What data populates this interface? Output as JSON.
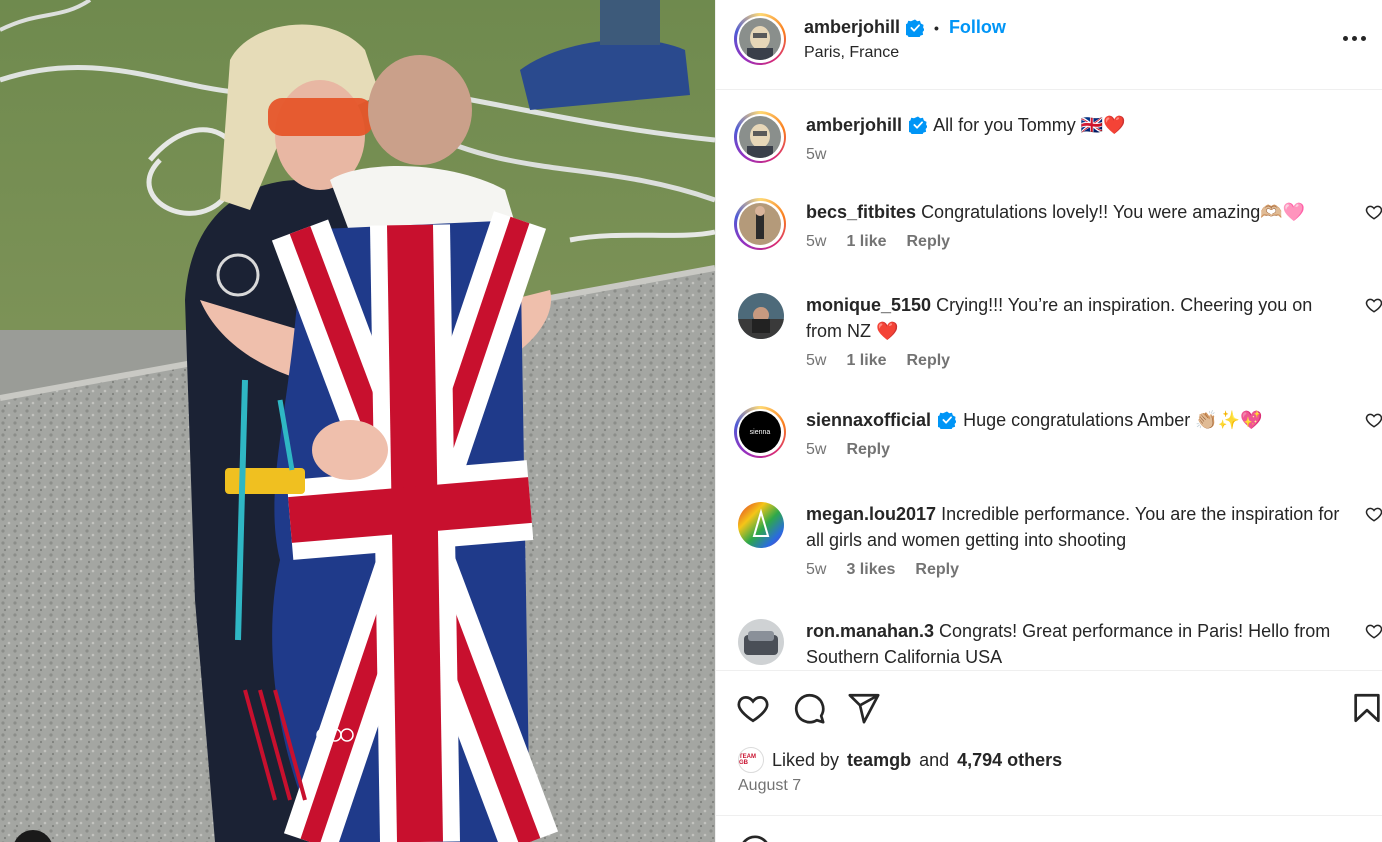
{
  "post": {
    "username": "amberjohill",
    "follow_label": "Follow",
    "separator": "•",
    "location": "Paris, France",
    "caption": {
      "username": "amberjohill",
      "text": "All for you Tommy 🇬🇧❤️",
      "time": "5w"
    }
  },
  "comments": [
    {
      "username": "becs_fitbites",
      "verified": false,
      "text": "Congratulations lovely!! You were amazing🫶🏼🩷",
      "time": "5w",
      "likes": "1 like",
      "reply": "Reply"
    },
    {
      "username": "monique_5150",
      "verified": false,
      "text": "Crying!!! You’re an inspiration. Cheering you on from NZ ❤️",
      "time": "5w",
      "likes": "1 like",
      "reply": "Reply"
    },
    {
      "username": "siennaxofficial",
      "verified": true,
      "text": "Huge congratulations Amber 👏🏼✨💖",
      "time": "5w",
      "likes": "",
      "reply": "Reply",
      "avatar_text": "sienna"
    },
    {
      "username": "megan.lou2017",
      "verified": false,
      "text": "Incredible performance. You are the inspiration for all girls and women getting into shooting",
      "time": "5w",
      "likes": "3 likes",
      "reply": "Reply"
    },
    {
      "username": "ron.manahan.3",
      "verified": false,
      "text": "Congrats! Great performance in Paris! Hello from Southern California USA",
      "time": "",
      "likes": "",
      "reply": ""
    }
  ],
  "likes": {
    "prefix": "Liked by",
    "user": "teamgb",
    "and": "and",
    "others": "4,794 others",
    "avatar_text": "TEAM GB"
  },
  "date": "August 7",
  "icons": {
    "like": "heart-icon",
    "comment": "comment-icon",
    "share": "share-icon",
    "save": "bookmark-icon",
    "more": "more-icon",
    "verified": "verified-badge-icon"
  },
  "colors": {
    "follow": "#0095f6",
    "verified": "#0095f6",
    "meta": "#737373",
    "text": "#262626"
  }
}
